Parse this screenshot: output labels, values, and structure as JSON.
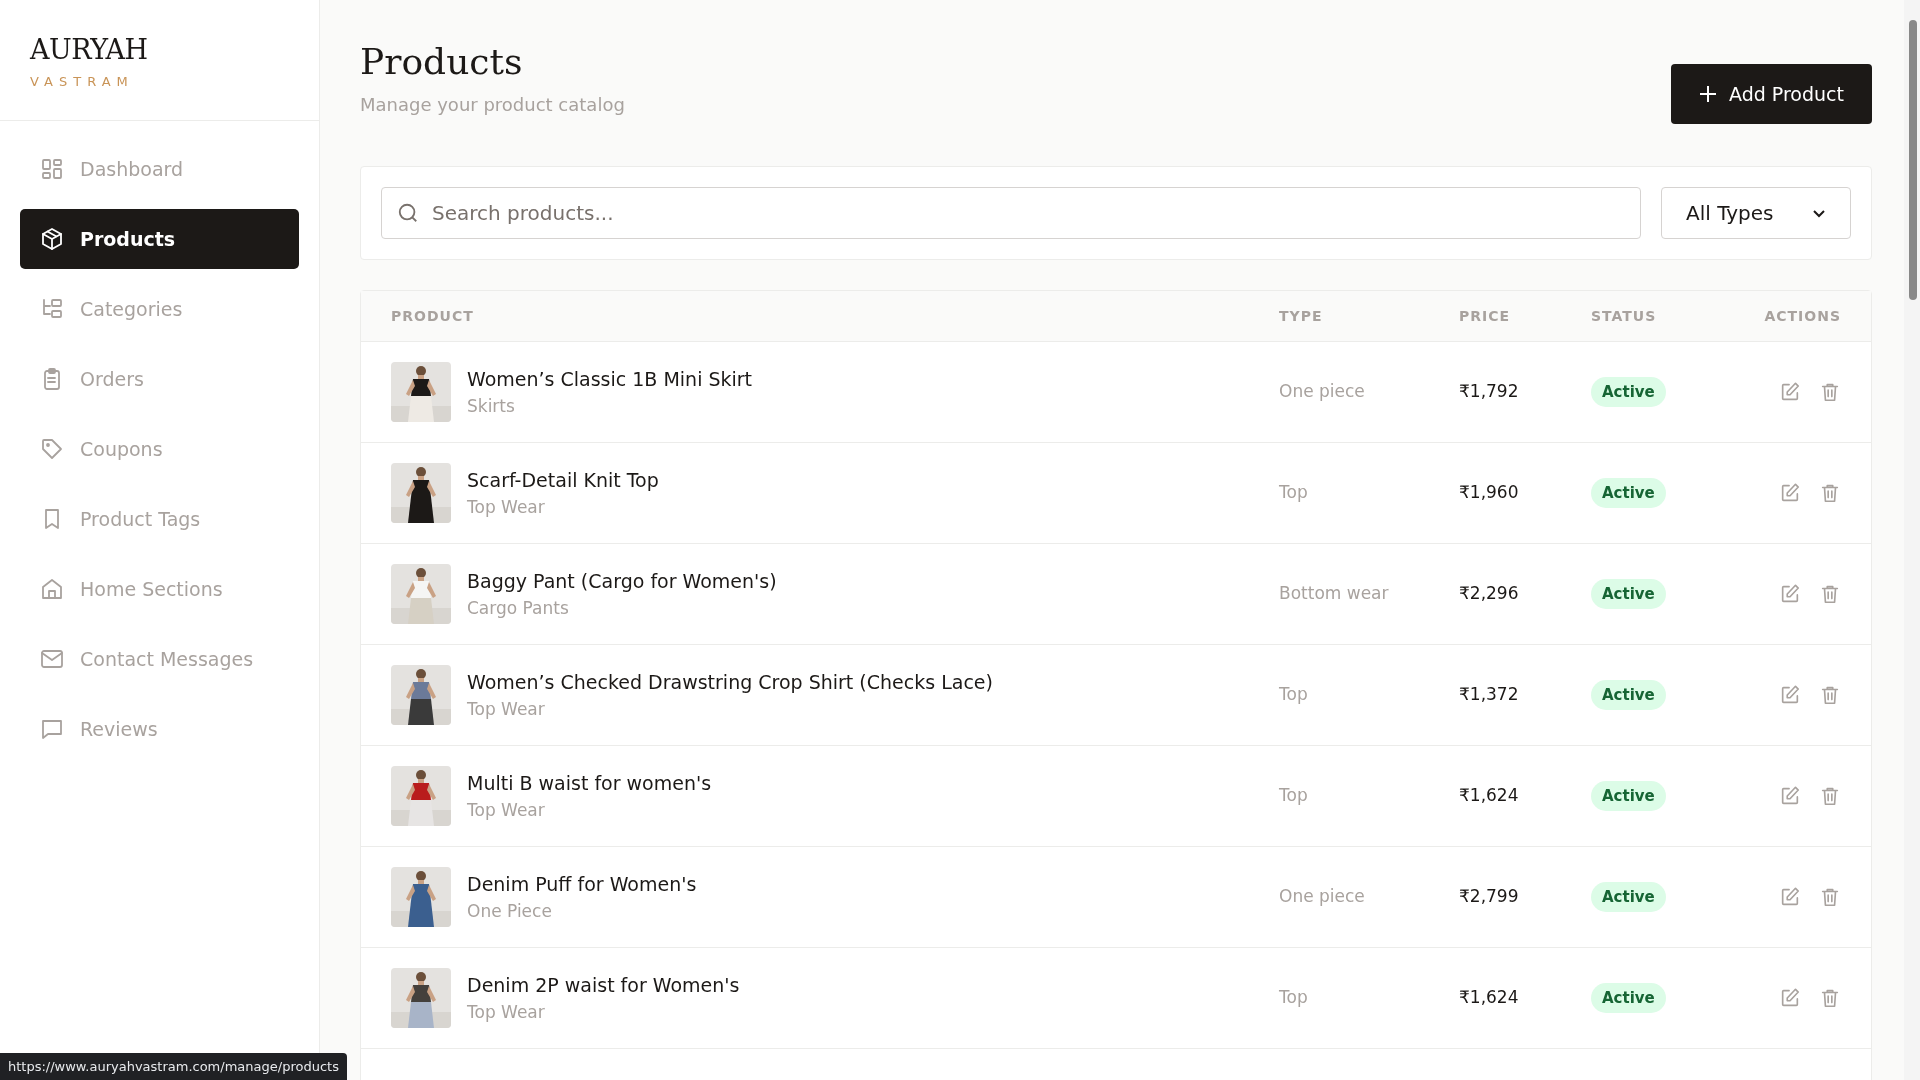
{
  "brand": {
    "name": "AURYAH",
    "tagline": "VASTRAM"
  },
  "sidebar": {
    "items": [
      {
        "label": "Dashboard",
        "selected": false
      },
      {
        "label": "Products",
        "selected": true
      },
      {
        "label": "Categories",
        "selected": false
      },
      {
        "label": "Orders",
        "selected": false
      },
      {
        "label": "Coupons",
        "selected": false
      },
      {
        "label": "Product Tags",
        "selected": false
      },
      {
        "label": "Home Sections",
        "selected": false
      },
      {
        "label": "Contact Messages",
        "selected": false
      },
      {
        "label": "Reviews",
        "selected": false
      }
    ]
  },
  "header": {
    "title": "Products",
    "subtitle": "Manage your product catalog",
    "add_button": "Add Product"
  },
  "filters": {
    "search": {
      "placeholder": "Search products..."
    },
    "type_select": {
      "value": "All Types"
    }
  },
  "table": {
    "columns": [
      "PRODUCT",
      "TYPE",
      "PRICE",
      "STATUS",
      "ACTIONS"
    ],
    "rows": [
      {
        "name": "Women’s Classic 1B Mini Skirt",
        "category": "Skirts",
        "type": "One piece",
        "price": "₹1,792",
        "status": "Active"
      },
      {
        "name": "Scarf-Detail Knit Top",
        "category": "Top Wear",
        "type": "Top",
        "price": "₹1,960",
        "status": "Active"
      },
      {
        "name": "Baggy Pant (Cargo for Women's)",
        "category": "Cargo Pants",
        "type": "Bottom wear",
        "price": "₹2,296",
        "status": "Active"
      },
      {
        "name": "Women’s Checked Drawstring Crop Shirt (Checks Lace)",
        "category": "Top Wear",
        "type": "Top",
        "price": "₹1,372",
        "status": "Active"
      },
      {
        "name": "Multi B waist for women's",
        "category": "Top Wear",
        "type": "Top",
        "price": "₹1,624",
        "status": "Active"
      },
      {
        "name": "Denim Puff for Women's",
        "category": "One Piece",
        "type": "One piece",
        "price": "₹2,799",
        "status": "Active"
      },
      {
        "name": "Denim 2P waist for Women's",
        "category": "Top Wear",
        "type": "Top",
        "price": "₹1,624",
        "status": "Active"
      }
    ]
  },
  "status_bar": {
    "url": "https://www.auryahvastram.com/manage/products"
  }
}
